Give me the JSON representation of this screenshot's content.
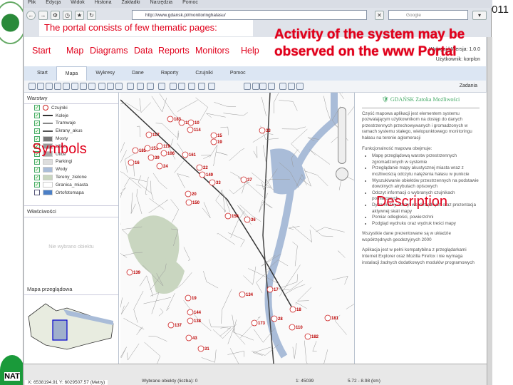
{
  "browser": {
    "menu": [
      "Plik",
      "Edycja",
      "Widok",
      "Historia",
      "Zakładki",
      "Narzędzia",
      "Pomoc"
    ],
    "url": "http://www.gdansk.pl/monitoringhalasu/",
    "search_placeholder": "Google"
  },
  "portal": {
    "header_right": "Wyloguj | Wersja: 1.0.0",
    "header_user": "Użytkownik: korplon",
    "tabs": [
      "Start",
      "Mapa",
      "Wykresy",
      "Dane",
      "Raporty",
      "Czujniki",
      "Pomoc"
    ],
    "active_tab": "Mapa",
    "tools_right": "Zadania",
    "layers_title": "Warstwy",
    "layers": [
      {
        "name": "Czujniki",
        "checked": true,
        "color": "#cc2222"
      },
      {
        "name": "Koleje",
        "checked": true,
        "color": "#333333"
      },
      {
        "name": "Tramwaje",
        "checked": true,
        "color": "#888888"
      },
      {
        "name": "Ekrany_akus",
        "checked": true,
        "color": "#555555"
      },
      {
        "name": "Mosty",
        "checked": true,
        "color": "#777777"
      },
      {
        "name": "Ulice",
        "checked": true,
        "color": "#999999"
      },
      {
        "name": "Ulice",
        "checked": true,
        "color": "#aaaaaa"
      },
      {
        "name": "Parkingi",
        "checked": true,
        "color": "#dddddd"
      },
      {
        "name": "Wody",
        "checked": true,
        "color": "#a9bcd8"
      },
      {
        "name": "Tereny_zielone",
        "checked": true,
        "color": "#c9d6c0"
      },
      {
        "name": "Granica_miasta",
        "checked": true,
        "color": "#ffffff"
      },
      {
        "name": "Ortofotomapa",
        "checked": false,
        "color": "#4b7fc6"
      }
    ],
    "properties_title": "Właściwości",
    "properties_empty": "Nie wybrano obiektu",
    "overview_title": "Mapa przeglądowa",
    "sensors": [
      "183",
      "11",
      "10",
      "114",
      "117",
      "33",
      "15",
      "19",
      "185",
      "151",
      "119",
      "106",
      "161",
      "16",
      "39",
      "24",
      "22",
      "149",
      "37",
      "33",
      "20",
      "150",
      "156",
      "36",
      "139",
      "17",
      "134",
      "19",
      "18",
      "144",
      "138",
      "137",
      "173",
      "28",
      "110",
      "181",
      "182",
      "43",
      "31"
    ],
    "gdansk_logo": "GDAŃSK Zatoka Możliwości",
    "description_intro": "Część mapowa aplikacji jest elementem systemu pozwalającym użytkownikom na dostęp do danych przestrzennych przechowywanych i gromadzonych w ramach systemu stałego, wielopunktowego monitoringu hałasu na terenie aglomeracji",
    "functions_title": "Funkcjonalność mapowa obejmuje:",
    "functions": [
      "Mapę przeglądową warstw przestrzennych zgromadzonych w systemie",
      "Przeglądanie mapy akustycznej miasta wraz z możliwością odczytu natężenia hałasu w punkcie",
      "Wyszukiwanie obiektów przestrzennych na podstawie dowolnych atrybutach opisowych",
      "Odczyt informacji o wybranych czujnikach pomiarowych",
      "Dynamiczny odczyt współrzędnych oraz prezentacja aktywnej skali mapy",
      "Pomiar odległości, powierzchni",
      "Podgląd wydruku oraz wydruk treści mapy"
    ],
    "coords_note": "Wszystkie dane prezentowane są w układzie współrzędnych geodezyjnych 2000",
    "compat_note": "Aplikacja jest w pełni kompatybilna z przeglądarkami Internet Explorer oraz Mozilla Firefox i nie wymaga instalacji żadnych dodatkowych modułów programowych"
  },
  "status": {
    "coords": "X: 6538194.91  Y: 6029507.57 (Metry)",
    "selected": "Wybrane obiekty (liczba): 0",
    "scale": "1: 45039",
    "zoom": "5.72 - 8.98 (km)"
  },
  "slide": {
    "callout_pages": "The portal consists of few thematic pages:",
    "nav": [
      "Start",
      "Map",
      "Diagrams",
      "Data",
      "Reports",
      "Monitors",
      "Help"
    ],
    "callout_activity_1": "Activity of the system may be",
    "callout_activity_2": "observed on the www Portal",
    "symbols": "Symbols",
    "description": "Description",
    "slide_number": "011",
    "logo_bottom": "NAT"
  }
}
